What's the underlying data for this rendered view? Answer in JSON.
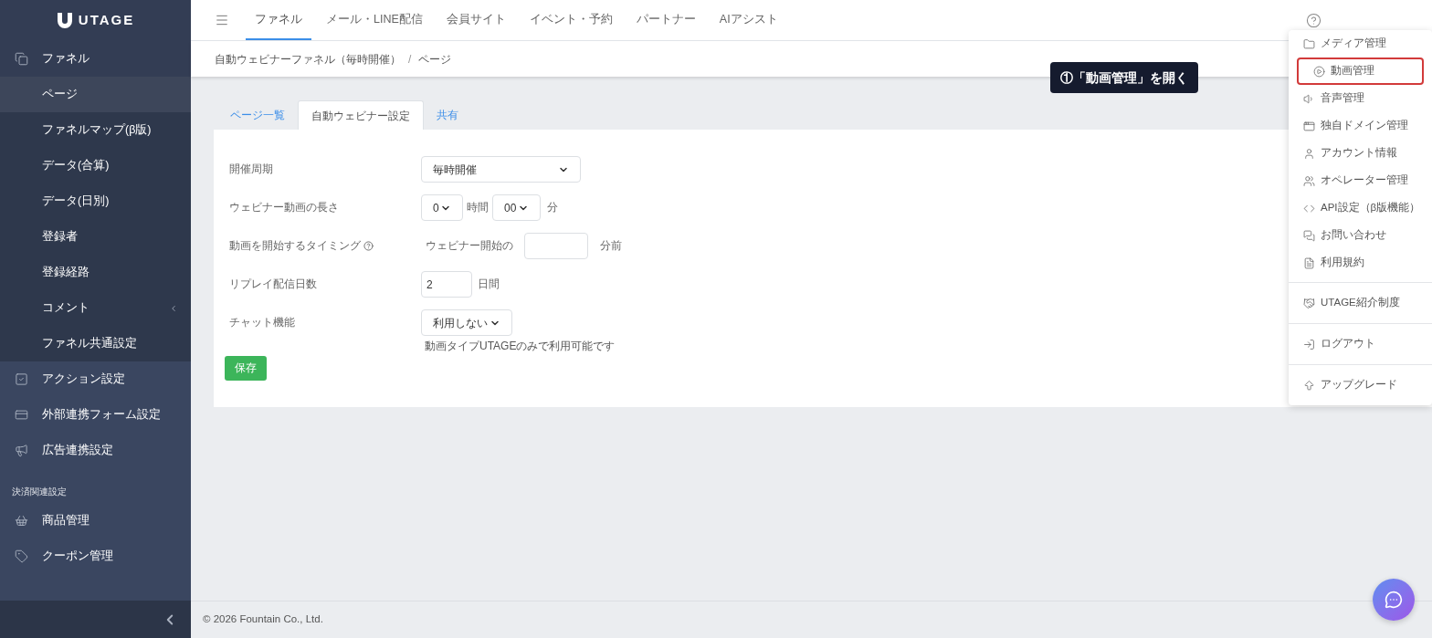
{
  "sidebar": {
    "logo": "UTAGE",
    "items": [
      {
        "kind": "group",
        "label": "ファネル",
        "selected": false
      },
      {
        "kind": "sub",
        "label": "ページ",
        "selected": true
      },
      {
        "kind": "sub",
        "label": "ファネルマップ(β版)",
        "selected": false
      },
      {
        "kind": "sub",
        "label": "データ(合算)",
        "selected": false
      },
      {
        "kind": "sub",
        "label": "データ(日別)",
        "selected": false
      },
      {
        "kind": "sub",
        "label": "登録者",
        "selected": false
      },
      {
        "kind": "sub",
        "label": "登録経路",
        "selected": false
      },
      {
        "kind": "sub",
        "label": "コメント",
        "selected": false,
        "expandable": true
      },
      {
        "kind": "sub",
        "label": "ファネル共通設定",
        "selected": false
      },
      {
        "kind": "group",
        "label": "アクション設定",
        "selected": false
      },
      {
        "kind": "group",
        "label": "外部連携フォーム設定",
        "selected": false
      },
      {
        "kind": "group",
        "label": "広告連携設定",
        "selected": false
      },
      {
        "kind": "heading",
        "label": "決済関連設定"
      },
      {
        "kind": "group",
        "label": "商品管理",
        "selected": false
      },
      {
        "kind": "group",
        "label": "クーポン管理",
        "selected": false
      }
    ]
  },
  "nav": [
    {
      "label": "ファネル",
      "selected": true
    },
    {
      "label": "メール・LINE配信",
      "selected": false
    },
    {
      "label": "会員サイト",
      "selected": false
    },
    {
      "label": "イベント・予約",
      "selected": false
    },
    {
      "label": "パートナー",
      "selected": false
    },
    {
      "label": "AIアシスト",
      "selected": false
    }
  ],
  "breadcrumb": [
    "自動ウェビナーファネル（毎時開催）",
    "/",
    "ページ"
  ],
  "tabs": [
    {
      "label": "ページ一覧",
      "selected": false
    },
    {
      "label": "自動ウェビナー設定",
      "selected": true
    },
    {
      "label": "共有",
      "selected": false
    }
  ],
  "form": [
    {
      "kind": "select",
      "label": "開催周期",
      "value": "毎時開催"
    },
    {
      "kind": "duration",
      "label": "ウェビナー動画の長さ",
      "hours": "0",
      "hours_unit": "時間",
      "minutes": "00",
      "minutes_unit": "分"
    },
    {
      "kind": "timing",
      "label": "動画を開始するタイミング",
      "help": true,
      "prefix": "ウェビナー開始の",
      "suffix": "分前"
    },
    {
      "kind": "number",
      "label": "リプレイ配信日数",
      "value": "2",
      "suffix": "日間"
    },
    {
      "kind": "select",
      "label": "チャット機能",
      "value": "利用しない",
      "note": "動画タイプUTAGEのみで利用可能です"
    }
  ],
  "save_button": "保存",
  "callout": "①「動画管理」を開く",
  "menu": [
    [
      {
        "label": "メディア管理",
        "highlighted": false
      },
      {
        "label": "動画管理",
        "highlighted": true
      },
      {
        "label": "音声管理",
        "highlighted": false
      },
      {
        "label": "独自ドメイン管理",
        "highlighted": false
      },
      {
        "label": "アカウント情報",
        "highlighted": false
      },
      {
        "label": "オペレーター管理",
        "highlighted": false
      },
      {
        "label": "API設定（β版機能）",
        "highlighted": false
      },
      {
        "label": "お問い合わせ",
        "highlighted": false
      },
      {
        "label": "利用規約",
        "highlighted": false
      }
    ],
    [
      {
        "label": "UTAGE紹介制度",
        "highlighted": false
      }
    ],
    [
      {
        "label": "ログアウト",
        "highlighted": false
      }
    ],
    [
      {
        "label": "アップグレード",
        "highlighted": false
      }
    ]
  ],
  "footer": "© 2026 Fountain Co., Ltd."
}
